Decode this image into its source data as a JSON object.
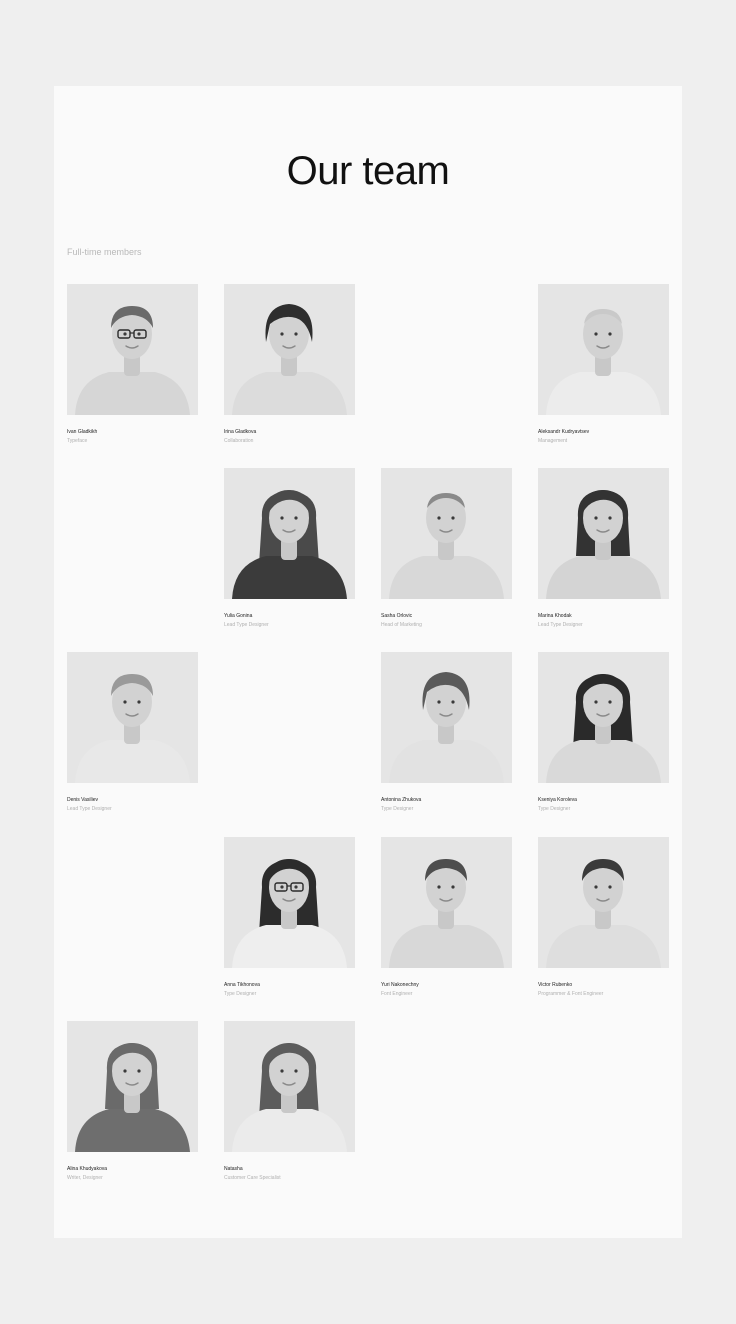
{
  "page": {
    "title": "Our team",
    "section_label": "Full-time members"
  },
  "members": [
    {
      "name": "Ivan Gladkikh",
      "role": "Typeface",
      "hair": "short",
      "hair_color": "#6a6a6a",
      "glasses": true,
      "shirt": "#d6d6d6"
    },
    {
      "name": "Irina Gladkova",
      "role": "Collaboration",
      "hair": "bob",
      "hair_color": "#2e2e2e",
      "glasses": false,
      "shirt": "#dcdcdc"
    },
    {
      "name": "Aleksandr Kudryavtsev",
      "role": "Management",
      "hair": "bald",
      "hair_color": "#c9c9c9",
      "glasses": false,
      "shirt": "#ececec"
    },
    {
      "name": "Yulia Gonina",
      "role": "Lead Type Designer",
      "hair": "long",
      "hair_color": "#4a4a4a",
      "glasses": false,
      "shirt": "#3b3b3b"
    },
    {
      "name": "Sasha Orlovic",
      "role": "Head of Marketing",
      "hair": "bald",
      "hair_color": "#8a8a8a",
      "glasses": false,
      "shirt": "#d8d8d8"
    },
    {
      "name": "Marina Khodak",
      "role": "Lead Type Designer",
      "hair": "medium",
      "hair_color": "#333333",
      "glasses": false,
      "shirt": "#d4d4d4"
    },
    {
      "name": "Denis Vasiliev",
      "role": "Lead Type Designer",
      "hair": "short",
      "hair_color": "#9a9a9a",
      "glasses": false,
      "shirt": "#e8e8e8"
    },
    {
      "name": "Antonina Zhukova",
      "role": "Type Designer",
      "hair": "bob",
      "hair_color": "#5a5a5a",
      "glasses": false,
      "shirt": "#e2e2e2"
    },
    {
      "name": "Kseniya Koroleva",
      "role": "Type Designer",
      "hair": "long",
      "hair_color": "#2a2a2a",
      "glasses": false,
      "shirt": "#d9d9d9"
    },
    {
      "name": "Anna Tikhonova",
      "role": "Type Designer",
      "hair": "long",
      "hair_color": "#2c2c2c",
      "glasses": true,
      "shirt": "#eeeeee"
    },
    {
      "name": "Yuri Nakonechny",
      "role": "Font Engineer",
      "hair": "short",
      "hair_color": "#4e4e4e",
      "glasses": false,
      "shirt": "#d8d8d8"
    },
    {
      "name": "Victor Rubenko",
      "role": "Programmer & Font Engineer",
      "hair": "short",
      "hair_color": "#3a3a3a",
      "glasses": false,
      "shirt": "#dedede"
    },
    {
      "name": "Alina Khudyakova",
      "role": "Writer, Designer",
      "hair": "medium",
      "hair_color": "#6a6a6a",
      "glasses": false,
      "shirt": "#6e6e6e"
    },
    {
      "name": "Natasha",
      "role": "Customer Care Specialist",
      "hair": "long",
      "hair_color": "#5c5c5c",
      "glasses": false,
      "shirt": "#ebebeb"
    }
  ]
}
